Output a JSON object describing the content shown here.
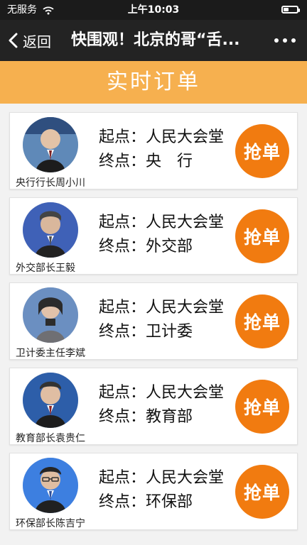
{
  "status_bar": {
    "carrier": "无服务",
    "time": "上午10:03"
  },
  "nav": {
    "back_label": "返回",
    "title": "快围观！北京的哥“舌..."
  },
  "banner": {
    "title": "实时订单"
  },
  "orders": [
    {
      "person": "央行行长周小川",
      "start": "起点：人民大会堂",
      "end": "终点：央　行",
      "button": "抢单"
    },
    {
      "person": "外交部长王毅",
      "start": "起点：人民大会堂",
      "end": "终点：外交部",
      "button": "抢单"
    },
    {
      "person": "卫计委主任李斌",
      "start": "起点：人民大会堂",
      "end": "终点：卫计委",
      "button": "抢单"
    },
    {
      "person": "教育部长袁贵仁",
      "start": "起点：人民大会堂",
      "end": "终点：教育部",
      "button": "抢单"
    },
    {
      "person": "环保部长陈吉宁",
      "start": "起点：人民大会堂",
      "end": "终点：环保部",
      "button": "抢单"
    }
  ],
  "colors": {
    "banner": "#f6b04f",
    "button": "#f17b10",
    "nav": "#232323"
  },
  "icons": {
    "back": "chevron-left-icon",
    "more": "more-dots-icon",
    "wifi": "wifi-icon",
    "battery": "battery-icon"
  }
}
